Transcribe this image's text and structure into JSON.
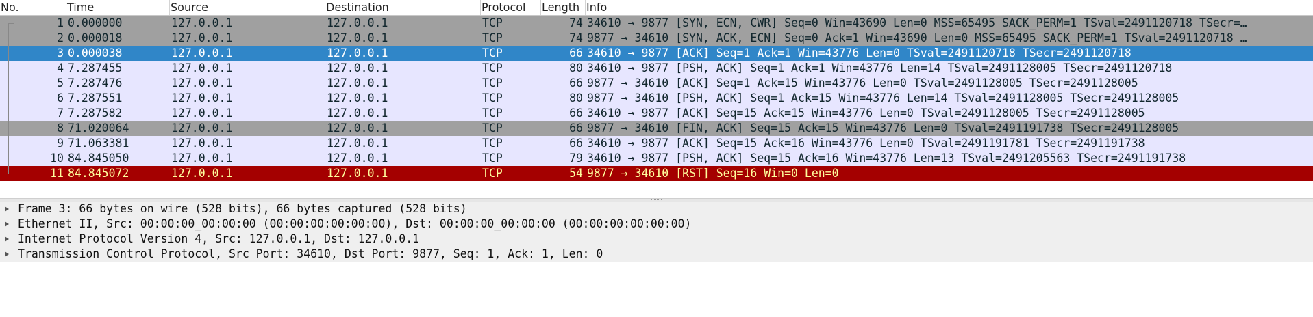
{
  "columns": {
    "no": "No.",
    "time": "Time",
    "source": "Source",
    "destination": "Destination",
    "protocol": "Protocol",
    "length": "Length",
    "info": "Info"
  },
  "packets": [
    {
      "no": "1",
      "time": "0.000000",
      "source": "127.0.0.1",
      "destination": "127.0.0.1",
      "protocol": "TCP",
      "length": "74",
      "info": "34610 → 9877 [SYN, ECN, CWR] Seq=0 Win=43690 Len=0 MSS=65495 SACK_PERM=1 TSval=2491120718 TSecr=…",
      "style": "gray"
    },
    {
      "no": "2",
      "time": "0.000018",
      "source": "127.0.0.1",
      "destination": "127.0.0.1",
      "protocol": "TCP",
      "length": "74",
      "info": "9877 → 34610 [SYN, ACK, ECN] Seq=0 Ack=1 Win=43690 Len=0 MSS=65495 SACK_PERM=1 TSval=2491120718 …",
      "style": "gray"
    },
    {
      "no": "3",
      "time": "0.000038",
      "source": "127.0.0.1",
      "destination": "127.0.0.1",
      "protocol": "TCP",
      "length": "66",
      "info": "34610 → 9877 [ACK] Seq=1 Ack=1 Win=43776 Len=0 TSval=2491120718 TSecr=2491120718",
      "style": "selected"
    },
    {
      "no": "4",
      "time": "7.287455",
      "source": "127.0.0.1",
      "destination": "127.0.0.1",
      "protocol": "TCP",
      "length": "80",
      "info": "34610 → 9877 [PSH, ACK] Seq=1 Ack=1 Win=43776 Len=14 TSval=2491128005 TSecr=2491120718",
      "style": "lavender"
    },
    {
      "no": "5",
      "time": "7.287476",
      "source": "127.0.0.1",
      "destination": "127.0.0.1",
      "protocol": "TCP",
      "length": "66",
      "info": "9877 → 34610 [ACK] Seq=1 Ack=15 Win=43776 Len=0 TSval=2491128005 TSecr=2491128005",
      "style": "lavender"
    },
    {
      "no": "6",
      "time": "7.287551",
      "source": "127.0.0.1",
      "destination": "127.0.0.1",
      "protocol": "TCP",
      "length": "80",
      "info": "9877 → 34610 [PSH, ACK] Seq=1 Ack=15 Win=43776 Len=14 TSval=2491128005 TSecr=2491128005",
      "style": "lavender"
    },
    {
      "no": "7",
      "time": "7.287582",
      "source": "127.0.0.1",
      "destination": "127.0.0.1",
      "protocol": "TCP",
      "length": "66",
      "info": "34610 → 9877 [ACK] Seq=15 Ack=15 Win=43776 Len=0 TSval=2491128005 TSecr=2491128005",
      "style": "lavender"
    },
    {
      "no": "8",
      "time": "71.020064",
      "source": "127.0.0.1",
      "destination": "127.0.0.1",
      "protocol": "TCP",
      "length": "66",
      "info": "9877 → 34610 [FIN, ACK] Seq=15 Ack=15 Win=43776 Len=0 TSval=2491191738 TSecr=2491128005",
      "style": "gray"
    },
    {
      "no": "9",
      "time": "71.063381",
      "source": "127.0.0.1",
      "destination": "127.0.0.1",
      "protocol": "TCP",
      "length": "66",
      "info": "34610 → 9877 [ACK] Seq=15 Ack=16 Win=43776 Len=0 TSval=2491191781 TSecr=2491191738",
      "style": "lavender"
    },
    {
      "no": "10",
      "time": "84.845050",
      "source": "127.0.0.1",
      "destination": "127.0.0.1",
      "protocol": "TCP",
      "length": "79",
      "info": "34610 → 9877 [PSH, ACK] Seq=15 Ack=16 Win=43776 Len=13 TSval=2491205563 TSecr=2491191738",
      "style": "lavender"
    },
    {
      "no": "11",
      "time": "84.845072",
      "source": "127.0.0.1",
      "destination": "127.0.0.1",
      "protocol": "TCP",
      "length": "54",
      "info": "9877 → 34610 [RST] Seq=16 Win=0 Len=0",
      "style": "rst"
    }
  ],
  "row_styles": {
    "gray": {
      "bg": "#a0a0a0",
      "fg": "#12272e"
    },
    "selected": {
      "bg": "#3086c8",
      "fg": "#ffffff"
    },
    "lavender": {
      "bg": "#e7e6ff",
      "fg": "#12272e"
    },
    "rst": {
      "bg": "#a40000",
      "fg": "#fffc9c"
    }
  },
  "details": [
    "Frame 3: 66 bytes on wire (528 bits), 66 bytes captured (528 bits)",
    "Ethernet II, Src: 00:00:00_00:00:00 (00:00:00:00:00:00), Dst: 00:00:00_00:00:00 (00:00:00:00:00:00)",
    "Internet Protocol Version 4, Src: 127.0.0.1, Dst: 127.0.0.1",
    "Transmission Control Protocol, Src Port: 34610, Dst Port: 9877, Seq: 1, Ack: 1, Len: 0"
  ],
  "icons": {
    "expand": "triangle-right-icon"
  }
}
